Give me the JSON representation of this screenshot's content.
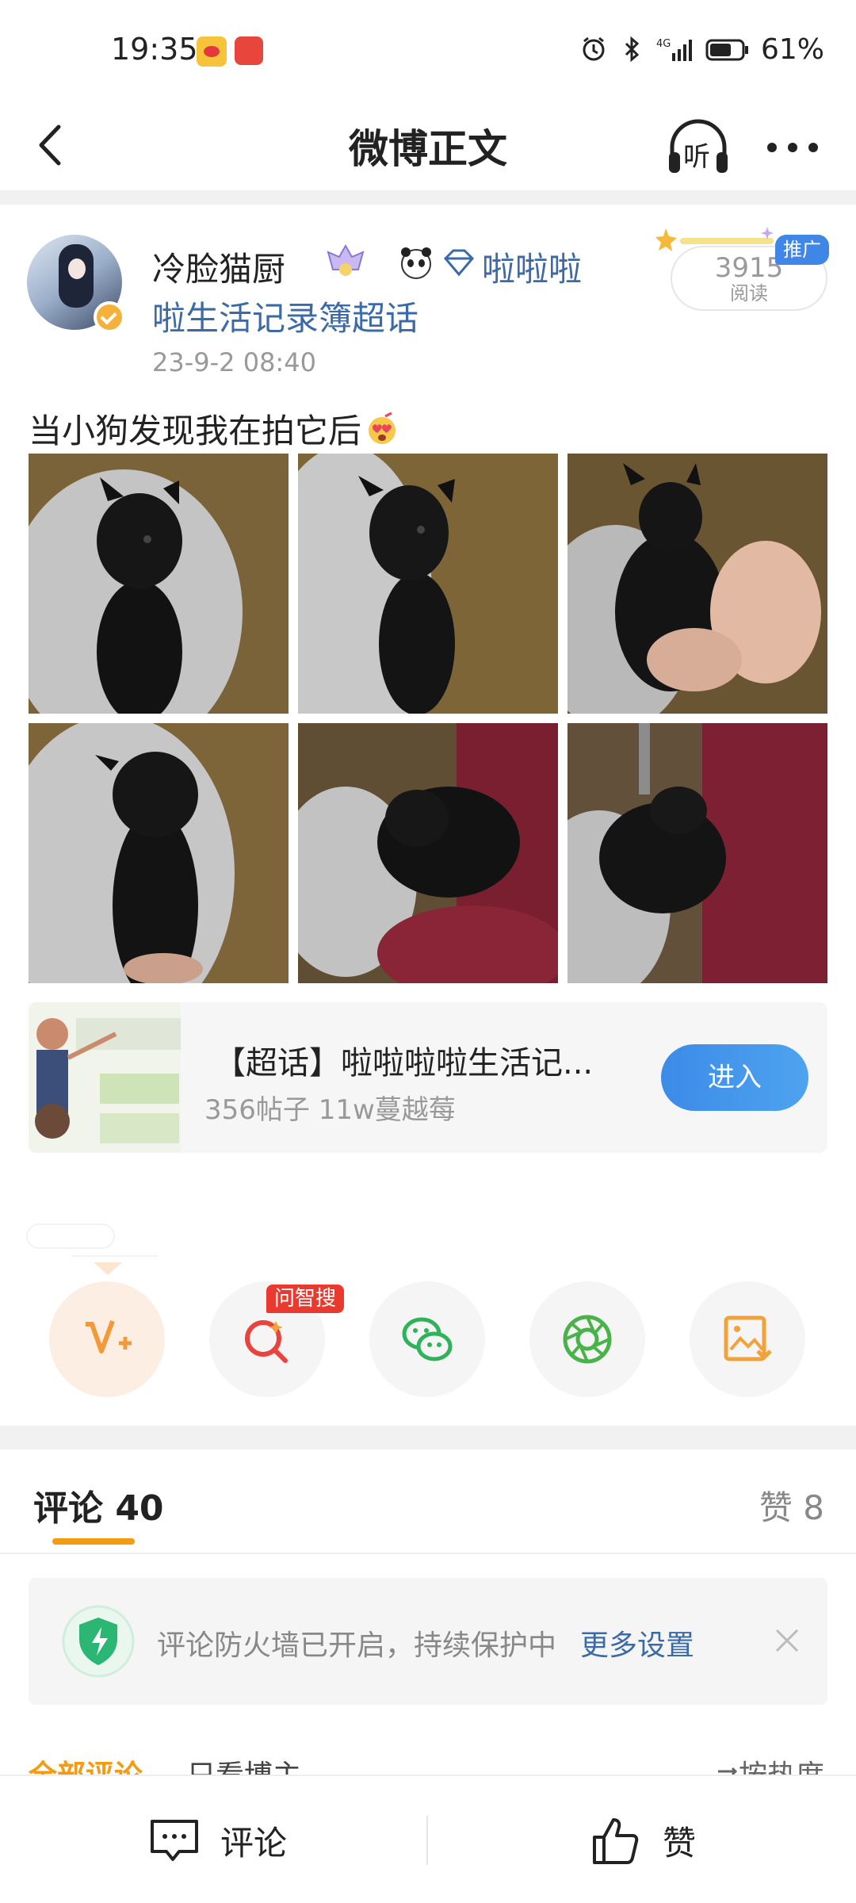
{
  "status_bar": {
    "time": "19:35",
    "battery": "61%",
    "icons": [
      "weibo-app-icon",
      "huawei-app-icon",
      "alarm-icon",
      "bluetooth-icon",
      "signal-4g-icon",
      "battery-icon"
    ]
  },
  "header": {
    "title": "微博正文",
    "listen_label": "听"
  },
  "post": {
    "author": "冷脸猫厨",
    "topic_line1": "啦啦啦",
    "topic_line2": "啦生活记录簿超话",
    "time": "23-9-2 08:40",
    "reads_count": "3915",
    "reads_label": "阅读",
    "promo_label": "推广",
    "text": "当小狗发现我在拍它后",
    "photos": [
      "dog-photo-1",
      "dog-photo-2",
      "dog-photo-3",
      "dog-photo-4",
      "dog-photo-5",
      "dog-photo-6"
    ]
  },
  "supertopic": {
    "title": "【超话】啦啦啦啦生活记...",
    "stats": "356帖子 11w蔓越莓",
    "enter_label": "进入"
  },
  "share": {
    "ask_tag": "问智搜",
    "items": [
      "vplus-icon",
      "ask-search-icon",
      "wechat-icon",
      "moments-icon",
      "save-image-icon"
    ]
  },
  "comments": {
    "title": "评论 40",
    "likes": "赞 8",
    "firewall_text": "评论防火墙已开启，持续保护中",
    "firewall_link": "更多设置",
    "filter_all": "全部评论",
    "filter_owner": "只看博主",
    "sort_label": "按热度"
  },
  "bottom_bar": {
    "comment_label": "评论",
    "like_label": "赞"
  },
  "colors": {
    "link_blue": "#3b6aa6",
    "accent_orange": "#f39c12",
    "enter_blue": "#3c8be8",
    "red_tag": "#ea3a2f"
  }
}
